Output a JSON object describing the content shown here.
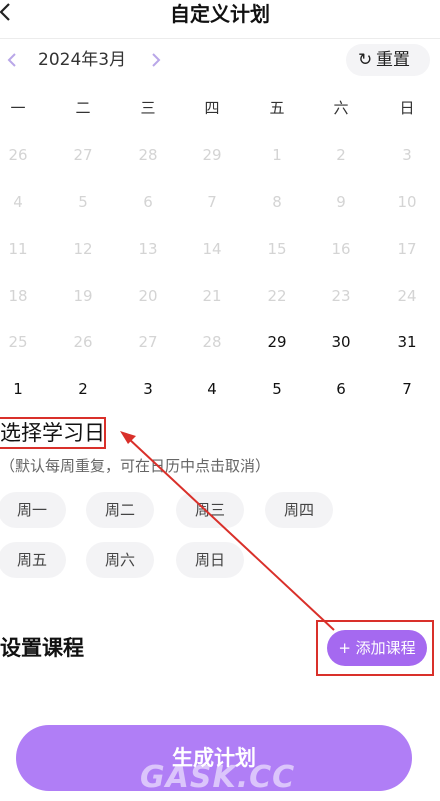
{
  "header": {
    "title": "自定义计划",
    "back_icon": "chevron-left-icon"
  },
  "calendar": {
    "month_label": "2024年3月",
    "prev_icon": "<",
    "next_icon": ">",
    "reset_label": "重置",
    "reset_icon": "↻",
    "weekdays": [
      "一",
      "二",
      "三",
      "四",
      "五",
      "六",
      "日"
    ],
    "weeks": [
      [
        "26",
        "27",
        "28",
        "29",
        "1",
        "2",
        "3"
      ],
      [
        "4",
        "5",
        "6",
        "7",
        "8",
        "9",
        "10"
      ],
      [
        "11",
        "12",
        "13",
        "14",
        "15",
        "16",
        "17"
      ],
      [
        "18",
        "19",
        "20",
        "21",
        "22",
        "23",
        "24"
      ],
      [
        "25",
        "26",
        "27",
        "28",
        "29",
        "30",
        "31"
      ],
      [
        "1",
        "2",
        "3",
        "4",
        "5",
        "6",
        "7"
      ]
    ]
  },
  "study_days": {
    "title": "选择学习日",
    "hint": "（默认每周重复，可在日历中点击取消）",
    "days": [
      "周一",
      "周二",
      "周三",
      "周四",
      "周五",
      "周六",
      "周日"
    ]
  },
  "courses": {
    "title": "设置课程",
    "add_label": "+ 添加课程"
  },
  "generate_label": "生成计划",
  "watermark": "GASK.CC",
  "colors": {
    "accent": "#a569f0",
    "button": "#b07ef6",
    "annotation": "#d9302a"
  }
}
